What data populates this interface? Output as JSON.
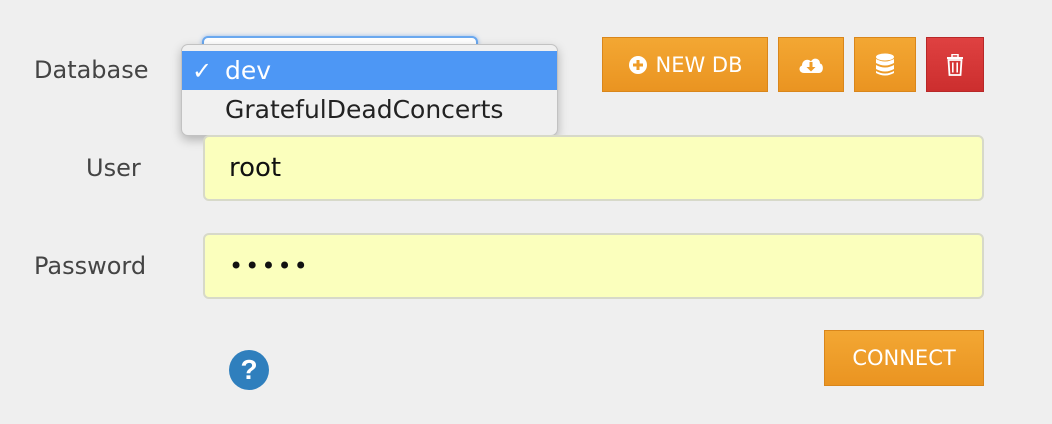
{
  "form": {
    "database_label": "Database",
    "user_label": "User",
    "password_label": "Password",
    "user_value": "root",
    "password_value": "•••••"
  },
  "database_dropdown": {
    "options": [
      {
        "label": "dev",
        "selected": true
      },
      {
        "label": "GratefulDeadConcerts",
        "selected": false
      }
    ]
  },
  "toolbar": {
    "new_db_label": "NEW DB",
    "icons": {
      "new_db": "plus-circle-icon",
      "export": "cloud-download-icon",
      "databases": "database-icon",
      "delete": "trash-icon"
    }
  },
  "actions": {
    "connect_label": "CONNECT",
    "help_icon": "question-circle-icon"
  },
  "colors": {
    "accent_orange": "#ef9c27",
    "danger_red": "#d63636",
    "input_bg": "#fbffbd",
    "selection_blue": "#4d97f5",
    "help_blue": "#2f7fbd"
  }
}
